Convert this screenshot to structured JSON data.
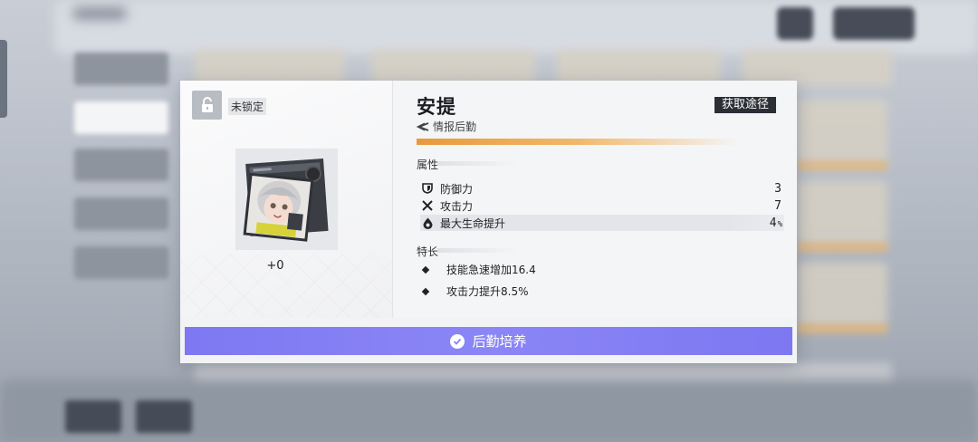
{
  "lock": {
    "icon": "lock-icon",
    "label": "未锁定"
  },
  "item": {
    "portrait_icon": "character-portrait",
    "level": "+0",
    "name": "安提",
    "acquire_label": "获取途径",
    "role": {
      "icon": "intel-arrow-icon",
      "label": "情报后勤"
    },
    "rarity_color": "#e89a3c"
  },
  "attributes": {
    "title": "属性",
    "stats": [
      {
        "icon": "shield-icon",
        "name": "防御力",
        "value": "3",
        "unit": ""
      },
      {
        "icon": "crossed-swords-icon",
        "name": "攻击力",
        "value": "7",
        "unit": ""
      },
      {
        "icon": "blood-drop-icon",
        "name": "最大生命提升",
        "value": "4",
        "unit": "%"
      }
    ]
  },
  "traits": {
    "title": "特长",
    "items": [
      "技能急速增加16.4",
      "攻击力提升8.5%"
    ]
  },
  "train_button": {
    "icon": "check-circle-icon",
    "label": "后勤培养",
    "color": "#7e78f2"
  }
}
